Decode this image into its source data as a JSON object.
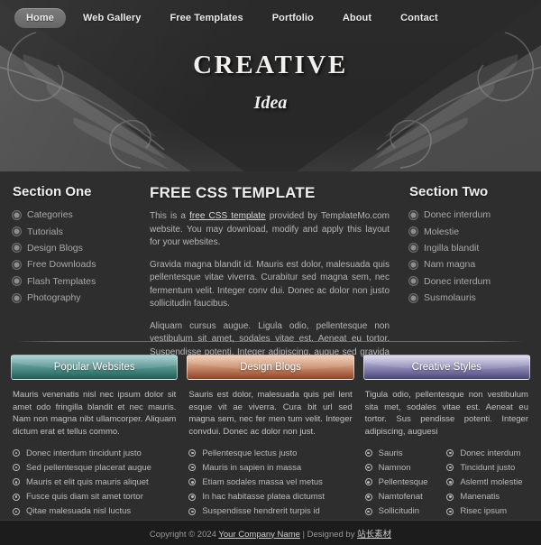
{
  "nav": {
    "items": [
      {
        "label": "Home",
        "active": true
      },
      {
        "label": "Web Gallery",
        "active": false
      },
      {
        "label": "Free Templates",
        "active": false
      },
      {
        "label": "Portfolio",
        "active": false
      },
      {
        "label": "About",
        "active": false
      },
      {
        "label": "Contact",
        "active": false
      }
    ]
  },
  "logo": {
    "main": "CREATIVE",
    "sub": "Idea"
  },
  "section_one": {
    "title": "Section One",
    "items": [
      "Categories",
      "Tutorials",
      "Design Blogs",
      "Free Downloads",
      "Flash Templates",
      "Photography"
    ]
  },
  "middle": {
    "title": "FREE CSS TEMPLATE",
    "intro_before": "This is a ",
    "intro_link": "free CSS template",
    "intro_after": " provided by TemplateMo.com website. You may download, modify and apply this layout for your websites.",
    "paragraph_2": "Gravida magna blandit id. Mauris est dolor, malesuada quis pellentesque vitae viverra. Curabitur sed magna sem, nec fermentum velit. Integer conv dui. Donec ac dolor non justo sollicitudin faucibus.",
    "paragraph_3": "Aliquam cursus augue. Ligula odio, pellentesque non vestibulum sit amet, sodales vitae est. Aeneat eu tortor. Suspendisse potenti. Integer adipiscing, augue sed gravida susci"
  },
  "section_two": {
    "title": "Section Two",
    "items": [
      "Donec interdum",
      "Molestie",
      "Ingilla blandit",
      "Nam magna",
      "Donec interdum",
      "Susmolauris"
    ]
  },
  "boxes": [
    {
      "title": "Popular Websites",
      "accent": "#1f5f55",
      "paragraph": "Mauris venenatis nisl nec ipsum dolor sit amet odo fringilla blandit et nec mauris. Nam non magna nibt ullamcorper. Aliquam dictum erat et tellus commo.",
      "items": [
        "Donec interdum tincidunt justo",
        "Sed pellentesque placerat augue",
        "Mauris et elit quis mauris aliquet",
        "Fusce quis diam sit amet tortor",
        "Qitae malesuada nisl luctus"
      ]
    },
    {
      "title": "Design Blogs",
      "accent": "#8e4426",
      "paragraph": "Sauris est dolor, malesuada quis pel lent esque vit ae viverra. Cura bit url sed magna sem, nec fer men tum velit. Integer convdui. Donec ac dolor non just.",
      "items": [
        "Pellentesque lectus justo",
        "Mauris in sapien in massa",
        "Etiam sodales massa vel metus",
        "In hac habitasse platea dictumst",
        "Suspendisse hendrerit turpis id"
      ]
    },
    {
      "title": "Creative Styles",
      "accent": "#4a4678",
      "paragraph": "Tigula odio, pellentesque non vestibulum sita met, sodales vitae est. Aeneat eu tortor. Sus pendisse potenti. Integer adipiscing, auguesi",
      "items_left": [
        "Sauris",
        "Namnon",
        "Pellentesque",
        "Namtofenat",
        "Sollicitudin"
      ],
      "items_right": [
        "Donec interdum",
        "Tincidunt justo",
        "Aslemtl molestie",
        "Manenatis",
        "Risec ipsum"
      ]
    }
  ],
  "footer": {
    "copyright_prefix": "Copyright © 2024 ",
    "company": "Your Company Name",
    "separator": " | Designed by ",
    "designer": "站长素材"
  }
}
